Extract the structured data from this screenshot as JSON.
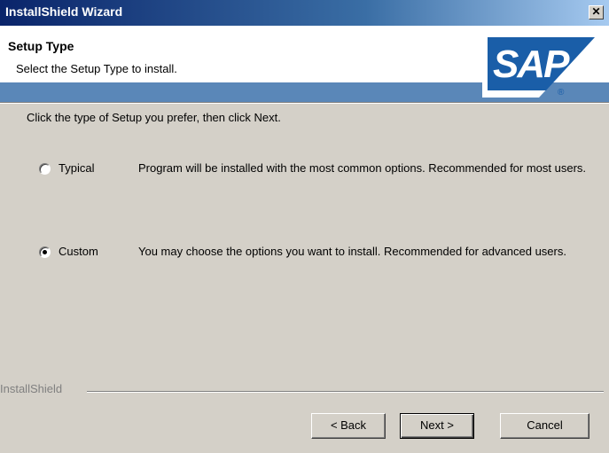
{
  "window": {
    "title": "InstallShield Wizard",
    "close_glyph": "✕"
  },
  "header": {
    "title": "Setup Type",
    "subtitle": "Select the Setup Type to install.",
    "logo_text": "SAP",
    "logo_registered": "®"
  },
  "body": {
    "instruction": "Click the type of Setup you prefer, then click Next.",
    "options": [
      {
        "label": "Typical",
        "description": "Program will be installed with the most common options.  Recommended for most users.",
        "selected": false
      },
      {
        "label": "Custom",
        "description": "You may choose the options you want to install. Recommended for advanced users.",
        "selected": true
      }
    ]
  },
  "footer": {
    "brand": "InstallShield",
    "back_label": "< Back",
    "next_label": "Next >",
    "cancel_label": "Cancel"
  },
  "colors": {
    "title_bar": "#0a246a",
    "header_band": "#5a87b8",
    "sap_blue": "#1a5ea8",
    "dialog_face": "#d4d0c8"
  },
  "icons": {
    "close": "close-icon",
    "logo": "sap-logo-icon"
  }
}
